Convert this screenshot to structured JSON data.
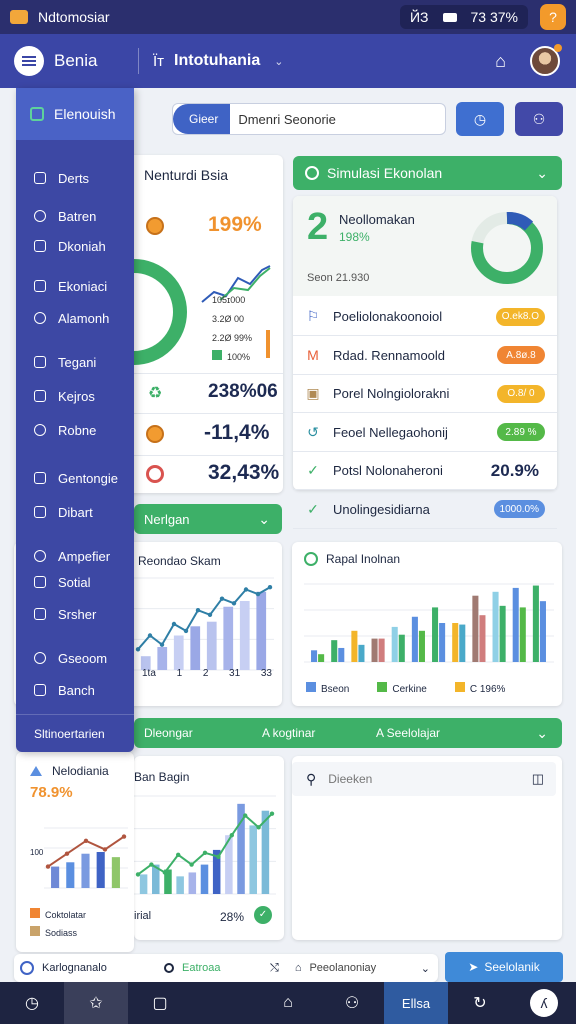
{
  "status": {
    "app_name": "Ndtomosiar",
    "signal": "ЙЗ",
    "time": "73 37%",
    "alert": "?"
  },
  "appbar": {
    "brand": "Benia",
    "title_prefix": "Ϊт",
    "title": "Intotuhania",
    "notify_icon": "bell-icon"
  },
  "sidebar": {
    "active": "Elenouish",
    "items": [
      {
        "label": "Derts"
      },
      {
        "label": "Batren"
      },
      {
        "label": "Dkoniah"
      },
      {
        "label": "Ekoniaci"
      },
      {
        "label": "Alamonh"
      },
      {
        "label": "Tegani"
      },
      {
        "label": "Kejros"
      },
      {
        "label": "Robne"
      },
      {
        "label": "Gentongie"
      },
      {
        "label": "Dibart"
      },
      {
        "label": "Ampefier"
      },
      {
        "label": "Sotial"
      },
      {
        "label": "Srsher"
      },
      {
        "label": "Gseoom"
      },
      {
        "label": "Banch"
      }
    ],
    "footer": "Sltinoertarien"
  },
  "search": {
    "tag": "Gieer",
    "value": "Dmenri Seonorie"
  },
  "card_stats": {
    "title": "Nenturdi Bsia",
    "stats": [
      "199%",
      "238%06",
      "-11,4%",
      "32,43%"
    ],
    "mini_legend": [
      "105ɪ000",
      "3.2Ø 00",
      "2.2Ø 99%",
      "100%"
    ]
  },
  "card_sim": {
    "header": "Simulasi Ekonolan",
    "big_num": "2",
    "name": "Neollomakan",
    "pct": "198%",
    "sub": "Seon 21.930",
    "donut": 0.78,
    "rows": [
      {
        "label": "Poeliolonakoonoiol",
        "badge": "O.ek8.O",
        "color": "#f3b52a"
      },
      {
        "label": "Rdad. Rennamoold",
        "badge": "A.8ø.8",
        "color": "#f08533"
      },
      {
        "label": "Porel Nolngiolorakni",
        "badge": "O.8/ 0",
        "color": "#f3b52a"
      },
      {
        "label": "Feoel Nellegaohonij",
        "badge": "2.89 %",
        "color": "#54b948"
      },
      {
        "label": "Potsl Nolonaheroni",
        "badge": "20.9%",
        "color": ""
      },
      {
        "label": "Unolingesidiarna",
        "badge": "1000.0%",
        "color": "#5b8fe0"
      }
    ]
  },
  "strip_green": {
    "label": "Nerlgan"
  },
  "chart_left": {
    "title": "Reondao Skam",
    "ticks": [
      "1ta",
      "1",
      "2",
      "31",
      "33"
    ]
  },
  "chart_right": {
    "title": "Rapal Inolnan",
    "legend": [
      "Bseon",
      "Cerkine",
      "C 196%"
    ]
  },
  "wide_header": {
    "left": "Dleongar",
    "mid": "A kogtinar",
    "right": "A Seelolajar"
  },
  "card_small": {
    "title": "Nelodiania",
    "pct": "78.9%",
    "ylabel": "100",
    "legend": [
      "Coktolatar",
      "Sodiass"
    ]
  },
  "chart_bottom": {
    "title": "Ban Bagin",
    "foot_left": "irial",
    "foot_pct": "28%"
  },
  "search2": {
    "placeholder": "Dieeken"
  },
  "footer_bar": {
    "left": "Karlognanalo",
    "mid": "Eatroaa",
    "mid2": "Peeolanoniay",
    "button": "Seelolanik"
  },
  "bottom_nav": {
    "active": "Ellsa"
  },
  "chart_data": [
    {
      "type": "bar",
      "title": "Reondao Skam",
      "categories": [
        "1ta",
        "1",
        "2",
        "31",
        "33"
      ],
      "series": [
        {
          "values": [
            12,
            20,
            30,
            38,
            42,
            55,
            60,
            68
          ]
        }
      ],
      "line": [
        18,
        30,
        22,
        40,
        34,
        52,
        48,
        62,
        58,
        70,
        66,
        72
      ]
    },
    {
      "type": "bar",
      "title": "Rapal Inolnan",
      "series": [
        {
          "name": "Bseon",
          "values": [
            15,
            28,
            40,
            30,
            45,
            58,
            70,
            50,
            85,
            90,
            95,
            98
          ]
        },
        {
          "name": "Cerkine",
          "values": [
            10,
            18,
            22,
            30,
            35,
            40,
            50,
            48,
            60,
            72,
            70,
            78
          ]
        }
      ]
    },
    {
      "type": "bar",
      "title": "Nelodiania",
      "ylabel": "100",
      "series": [
        {
          "values": [
            25,
            30,
            40,
            42,
            36
          ]
        }
      ],
      "line": [
        25,
        40,
        55,
        45,
        60
      ]
    },
    {
      "type": "bar",
      "title": "Ban Bagin",
      "series": [
        {
          "values": [
            20,
            30,
            25,
            18,
            22,
            30,
            45,
            60,
            92,
            70,
            85
          ]
        }
      ],
      "line": [
        20,
        30,
        22,
        40,
        30,
        42,
        38,
        60,
        80,
        68,
        82
      ]
    }
  ]
}
